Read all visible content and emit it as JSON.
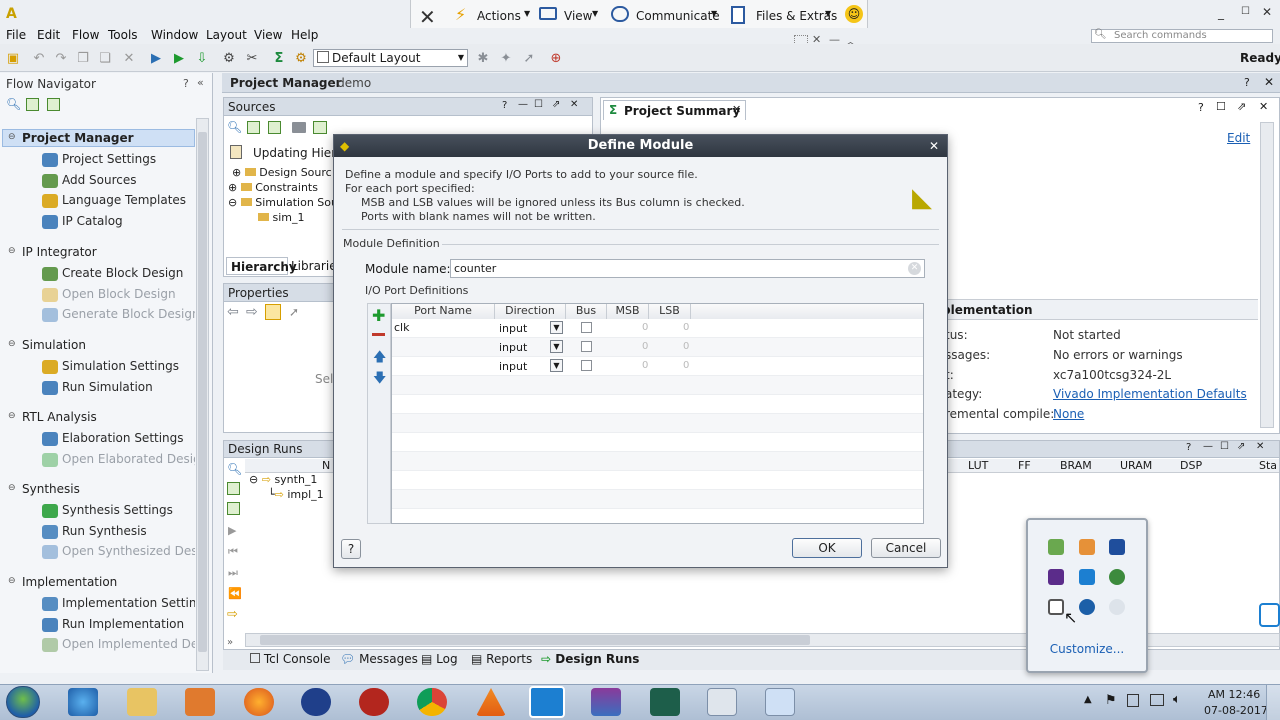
{
  "window": {
    "title_glyph": "A",
    "controls": [
      "_",
      "☐",
      "✕"
    ]
  },
  "menu": [
    "File",
    "Edit",
    "Flow",
    "Tools",
    "Window",
    "Layout",
    "View",
    "Help"
  ],
  "overlay_toolbar": {
    "actions": "Actions",
    "view": "View",
    "communicate": "Communicate",
    "files": "Files & Extras"
  },
  "toolbar": {
    "layout_value": "Default Layout",
    "search_placeholder": "Search commands",
    "status": "Ready"
  },
  "flow_nav": {
    "title": "Flow Navigator",
    "sections": [
      {
        "label": "Project Manager",
        "items": [
          "Project Settings",
          "Add Sources",
          "Language Templates",
          "IP Catalog"
        ]
      },
      {
        "label": "IP Integrator",
        "items": [
          "Create Block Design",
          "Open Block Design",
          "Generate Block Design"
        ]
      },
      {
        "label": "Simulation",
        "items": [
          "Simulation Settings",
          "Run Simulation"
        ]
      },
      {
        "label": "RTL Analysis",
        "items": [
          "Elaboration Settings",
          "Open Elaborated Design"
        ]
      },
      {
        "label": "Synthesis",
        "items": [
          "Synthesis Settings",
          "Run Synthesis",
          "Open Synthesized Design"
        ]
      },
      {
        "label": "Implementation",
        "items": [
          "Implementation Settings",
          "Run Implementation",
          "Open Implemented Design"
        ]
      }
    ]
  },
  "project": {
    "title": "Project Manager",
    "name": "- demo"
  },
  "sources": {
    "title": "Sources",
    "updating": "Updating Hierarchy",
    "tree": [
      "Design Sources",
      "Constraints",
      "Simulation Sources",
      "sim_1"
    ],
    "tabs": [
      "Hierarchy",
      "Libraries"
    ]
  },
  "properties": {
    "title": "Properties",
    "empty": "Select"
  },
  "design_runs": {
    "title": "Design Runs",
    "col_name": "N",
    "runs": [
      "synth_1",
      "impl_1"
    ],
    "cols": [
      "LUT",
      "FF",
      "BRAM",
      "URAM",
      "DSP",
      "Sta"
    ]
  },
  "summary": {
    "tab": "Project Summary",
    "edit": "Edit",
    "section": "plementation",
    "rows": [
      {
        "label": "tus:",
        "value": "Not started",
        "link": false
      },
      {
        "label": "ssages:",
        "value": "No errors or warnings",
        "link": false
      },
      {
        "label": "t:",
        "value": "xc7a100tcsg324-2L",
        "link": false
      },
      {
        "label": "ategy:",
        "value": "Vivado Implementation Defaults",
        "link": true
      },
      {
        "label": "remental compile:",
        "value": "None",
        "link": true
      }
    ]
  },
  "bottom_tabs": [
    "Tcl Console",
    "Messages",
    "Log",
    "Reports",
    "Design Runs"
  ],
  "dialog": {
    "title": "Define Module",
    "desc": [
      "Define a module and specify I/O Ports to add to your source file.",
      "For each port specified:",
      "MSB and LSB values will be ignored unless its Bus column is checked.",
      "Ports with blank names will not be written."
    ],
    "module_def": "Module Definition",
    "module_name_label": "Module name:",
    "module_name": "counter",
    "io_label": "I/O Port Definitions",
    "headers": [
      "Port Name",
      "Direction",
      "Bus",
      "MSB",
      "LSB"
    ],
    "ports": [
      {
        "name": "clk",
        "direction": "input",
        "msb": "0",
        "lsb": "0"
      },
      {
        "name": "",
        "direction": "input",
        "msb": "0",
        "lsb": "0"
      },
      {
        "name": "",
        "direction": "input",
        "msb": "0",
        "lsb": "0"
      }
    ],
    "help": "?",
    "ok": "OK",
    "cancel": "Cancel"
  },
  "tray_popup": {
    "customize": "Customize..."
  },
  "clock": {
    "time": "AM 12:46",
    "date": "07-08-2017"
  }
}
